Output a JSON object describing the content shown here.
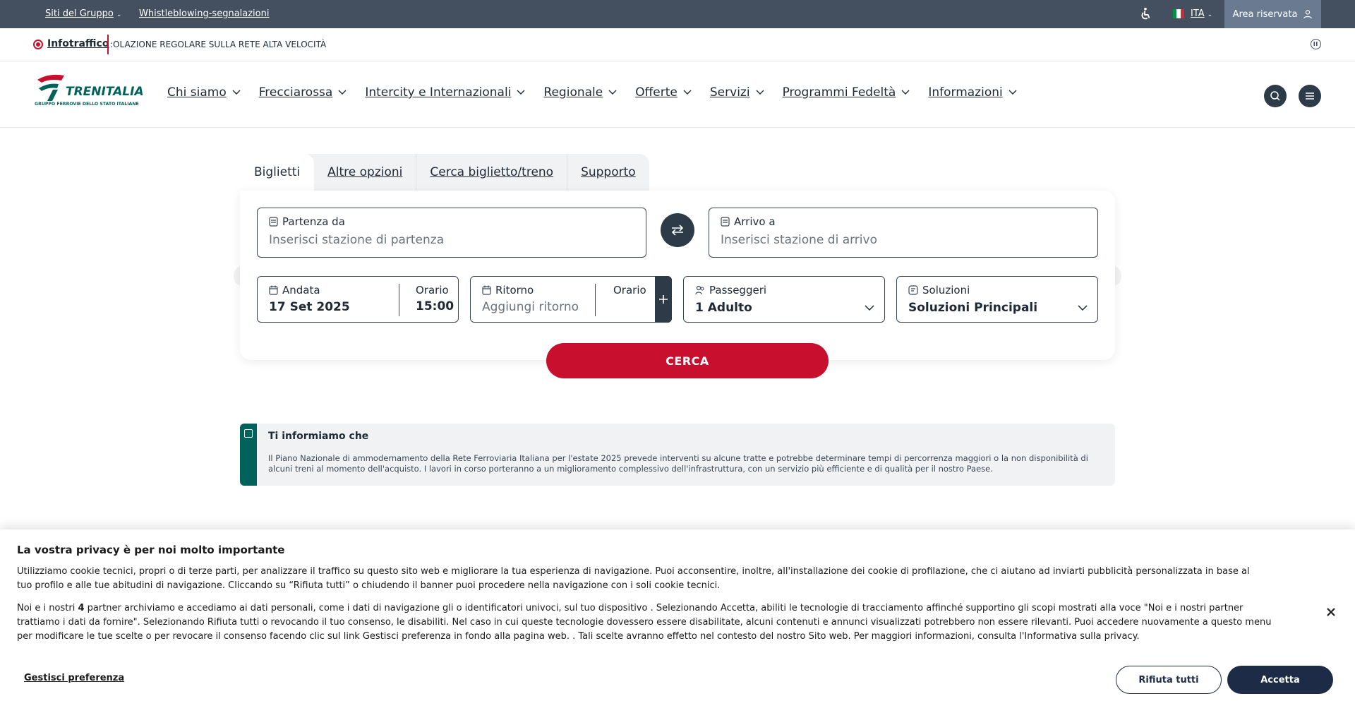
{
  "topbar": {
    "group_sites": "Siti del Gruppo",
    "whistleblowing": "Whistleblowing-segnalazioni",
    "language": "ITA",
    "reserved_area": "Area riservata",
    "bg_color": "#44505f"
  },
  "infotraffic": {
    "label": "Infotraffico",
    "message": ":OLAZIONE REGOLARE SULLA RETE ALTA VELOCITÀ"
  },
  "brand": {
    "name": "TRENITALIA",
    "tagline": "GRUPPO FERROVIE DELLO STATO ITALIANE",
    "red": "#c8102e",
    "green": "#00625a"
  },
  "nav": {
    "items": [
      {
        "label": "Chi siamo"
      },
      {
        "label": "Frecciarossa"
      },
      {
        "label": "Intercity e Internazionali"
      },
      {
        "label": "Regionale"
      },
      {
        "label": "Offerte"
      },
      {
        "label": "Servizi"
      },
      {
        "label": "Programmi Fedeltà"
      },
      {
        "label": "Informazioni"
      }
    ]
  },
  "search": {
    "tabs": [
      {
        "label": "Biglietti",
        "active": true
      },
      {
        "label": "Altre opzioni",
        "active": false
      },
      {
        "label": "Cerca biglietto/treno",
        "active": false
      },
      {
        "label": "Supporto",
        "active": false
      }
    ],
    "departure": {
      "label": "Partenza da",
      "placeholder": "Inserisci stazione di partenza"
    },
    "arrival": {
      "label": "Arrivo a",
      "placeholder": "Inserisci stazione di arrivo"
    },
    "outbound": {
      "label": "Andata",
      "date": "17 Set 2025",
      "time_label": "Orario",
      "time": "15:00"
    },
    "return": {
      "label": "Ritorno",
      "placeholder": "Aggiungi ritorno",
      "time_label": "Orario"
    },
    "passengers": {
      "label": "Passeggeri",
      "value": "1 Adulto"
    },
    "solutions": {
      "label": "Soluzioni",
      "value": "Soluzioni Principali"
    },
    "submit": "CERCA"
  },
  "notice": {
    "title": "Ti informiamo che",
    "text": "Il Piano Nazionale di ammodernamento della Rete Ferroviaria Italiana per l'estate 2025 prevede interventi su alcune tratte e potrebbe determinare tempi di percorrenza maggiori o la non disponibilità di alcuni treni al momento dell'acquisto. I lavori in corso porteranno a un miglioramento complessivo dell'infrastruttura, con un servizio più efficiente e di qualità per il nostro Paese."
  },
  "cookie": {
    "title": "La vostra privacy è per noi molto importante",
    "paragraph1": "Utilizziamo cookie tecnici, propri o di terze parti, per analizzare il traffico su questo sito web e migliorare la tua esperienza di navigazione. Puoi acconsentire, inoltre, all'installazione dei cookie di profilazione, che ci aiutano ad inviarti pubblicità personalizzata in base al tuo profilo e alle tue abitudini di navigazione. Cliccando su “Rifiuta tutti” o chiudendo il banner puoi procedere nella navigazione con i soli cookie tecnici.",
    "p2_before": "Noi e i nostri ",
    "p2_count": "4",
    "p2_after": " partner archiviamo e accediamo ai dati personali, come i dati di navigazione gli o identificatori univoci, sul tuo dispositivo . Selezionando Accetta, abiliti le tecnologie di tracciamento affinché supportino gli scopi mostrati alla voce \"Noi e i nostri partner trattiamo i dati da fornire\". Selezionando Rifiuta tutti o revocando il tuo consenso, le disabiliti. Nel caso in cui queste tecnologie dovessero essere disabilitate, alcuni contenuti e annunci visualizzati potrebbero non essere rilevanti. Puoi accedere nuovamente a questo menu per modificare le tue scelte o per revocare il consenso facendo clic sul link Gestisci preferenza in fondo alla pagina web. . Tali scelte avranno effetto nel contesto del nostro Sito web. Per maggiori informazioni, consulta l'Informativa sulla privacy.",
    "manage": "Gestisci preferenza",
    "reject": "Rifiuta tutti",
    "accept": "Accetta"
  }
}
